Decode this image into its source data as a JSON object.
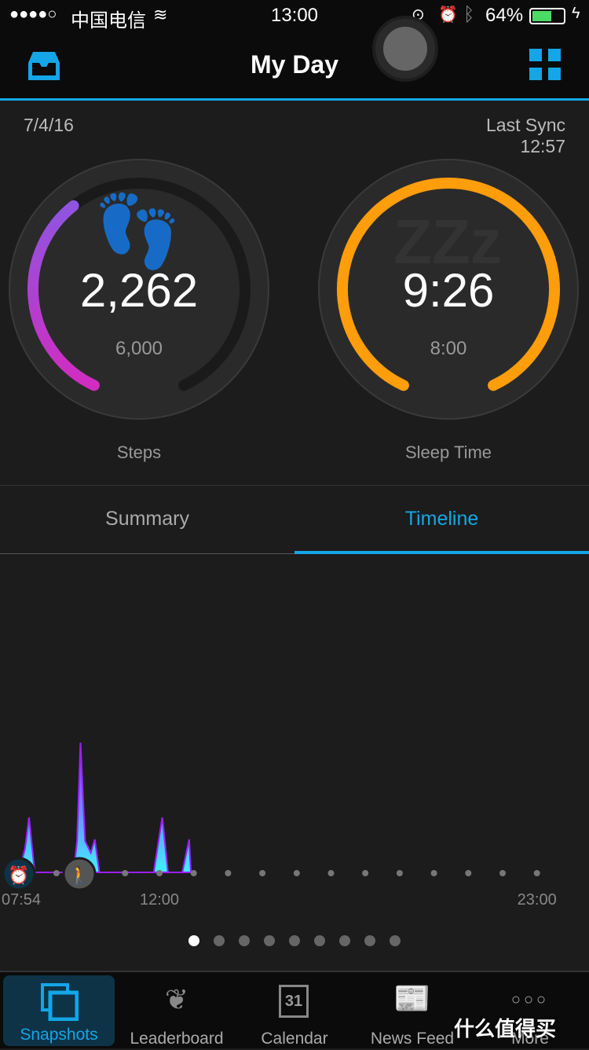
{
  "status_bar": {
    "signal": "●●●●○",
    "carrier": "中国电信",
    "time": "13:00",
    "battery": "64%",
    "battery_level": 0.64,
    "icons": [
      "wifi-icon",
      "rotation-lock-icon",
      "alarm-icon",
      "bluetooth-icon",
      "battery-icon",
      "charging-icon"
    ]
  },
  "header": {
    "title": "My Day",
    "left_icon": "inbox-icon",
    "right_icon": "grid-icon",
    "accent": "#14a6e6"
  },
  "date": "7/4/16",
  "sync": {
    "label": "Last Sync",
    "time": "12:57"
  },
  "steps": {
    "value": "2,262",
    "goal": "6,000",
    "label": "Steps",
    "progress": 0.377,
    "colors": [
      "#9b50e0",
      "#d02fc0"
    ]
  },
  "sleep": {
    "value": "9:26",
    "goal": "8:00",
    "label": "Sleep Time",
    "progress": 1.0,
    "color": "#ff9d0a"
  },
  "tabs": [
    {
      "label": "Summary",
      "active": false
    },
    {
      "label": "Timeline",
      "active": true
    }
  ],
  "chart_data": {
    "type": "area",
    "x_ticks": [
      "07:54",
      "12:00",
      "23:00"
    ],
    "xlim": [
      "07:54",
      "23:00"
    ],
    "x": [
      "07:54",
      "08:05",
      "08:12",
      "08:22",
      "09:30",
      "09:36",
      "09:42",
      "09:50",
      "10:00",
      "10:07",
      "10:15",
      "11:50",
      "12:05",
      "12:15",
      "12:40",
      "12:52",
      "12:55"
    ],
    "values": [
      0,
      30,
      70,
      0,
      0,
      40,
      165,
      40,
      25,
      42,
      0,
      0,
      70,
      0,
      0,
      42,
      0
    ],
    "markers": [
      {
        "time": "07:54",
        "icon": "alarm-icon"
      },
      {
        "time": "09:30",
        "icon": "walking-icon"
      }
    ],
    "colors": [
      "#3ff0ff",
      "#9a20ff"
    ]
  },
  "pager": {
    "count": 9,
    "active": 0
  },
  "tabbar": [
    {
      "label": "Snapshots",
      "icon": "snapshots-icon",
      "active": true
    },
    {
      "label": "Leaderboard",
      "icon": "laurel-icon"
    },
    {
      "label": "Calendar",
      "icon": "calendar-icon",
      "day": "31"
    },
    {
      "label": "News Feed",
      "icon": "newspaper-icon"
    },
    {
      "label": "More",
      "icon": "more-icon"
    }
  ],
  "watermark": "什么值得买"
}
